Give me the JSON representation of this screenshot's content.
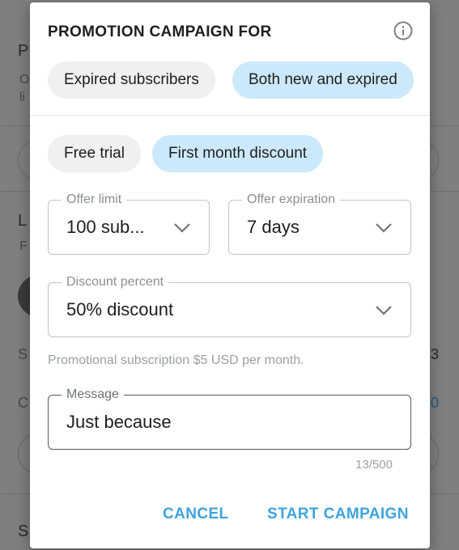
{
  "background": {
    "items": [
      "P",
      "O",
      "li",
      "L",
      "F",
      "S",
      "3",
      "C",
      "0",
      "S"
    ]
  },
  "dialog": {
    "title": "PROMOTION CAMPAIGN FOR",
    "audience_options": [
      {
        "label": "Expired subscribers",
        "selected": false
      },
      {
        "label": "Both new and expired",
        "selected": true
      }
    ],
    "type_options": [
      {
        "label": "Free trial",
        "selected": false
      },
      {
        "label": "First month discount",
        "selected": true
      }
    ],
    "offer_limit": {
      "label": "Offer limit",
      "value": "100 sub..."
    },
    "offer_expiration": {
      "label": "Offer expiration",
      "value": "7 days"
    },
    "discount_percent": {
      "label": "Discount percent",
      "value": "50% discount"
    },
    "helper_text": "Promotional subscription $5 USD per month.",
    "message": {
      "label": "Message",
      "value": "Just because",
      "counter": "13/500"
    },
    "actions": {
      "cancel": "CANCEL",
      "start": "START CAMPAIGN"
    }
  },
  "colors": {
    "accent": "#3ea3df",
    "chip_selected": "#cce9fb",
    "chip_default": "#eef0f2"
  }
}
